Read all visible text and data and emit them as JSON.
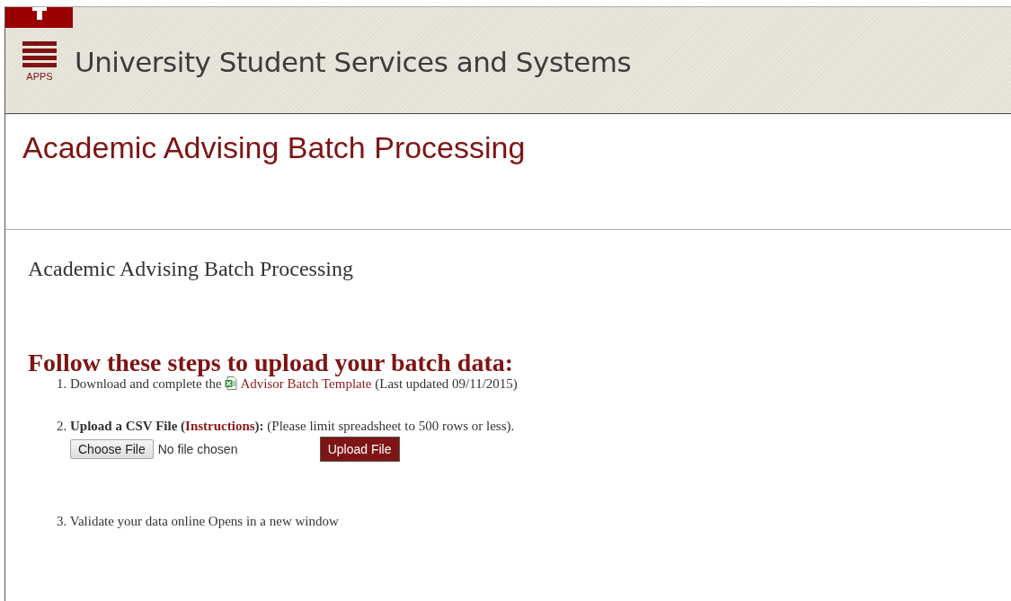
{
  "header": {
    "apps_label": "APPS",
    "site_title": "University Student Services and Systems"
  },
  "page_title": "Academic Advising Batch Processing",
  "section_title": "Academic Advising Batch Processing",
  "steps_heading": "Follow these steps to upload your batch data:",
  "steps": [
    {
      "kind": "download",
      "number": "1.",
      "text_before": "Download and complete the",
      "link": "Advisor Batch Template",
      "text_after": "(Last updated 09/11/2015)"
    },
    {
      "kind": "upload",
      "number": "2.",
      "label_before": "Upload a CSV File (",
      "link": "Instructions",
      "label_after": "):",
      "note": "(Please limit spreadsheet to 500 rows or less).",
      "file_button": "Choose File",
      "file_status": "No file chosen",
      "submit": "Upload File"
    },
    {
      "kind": "validate",
      "number": "3.",
      "text": "Validate your data online Opens in a new window"
    }
  ]
}
